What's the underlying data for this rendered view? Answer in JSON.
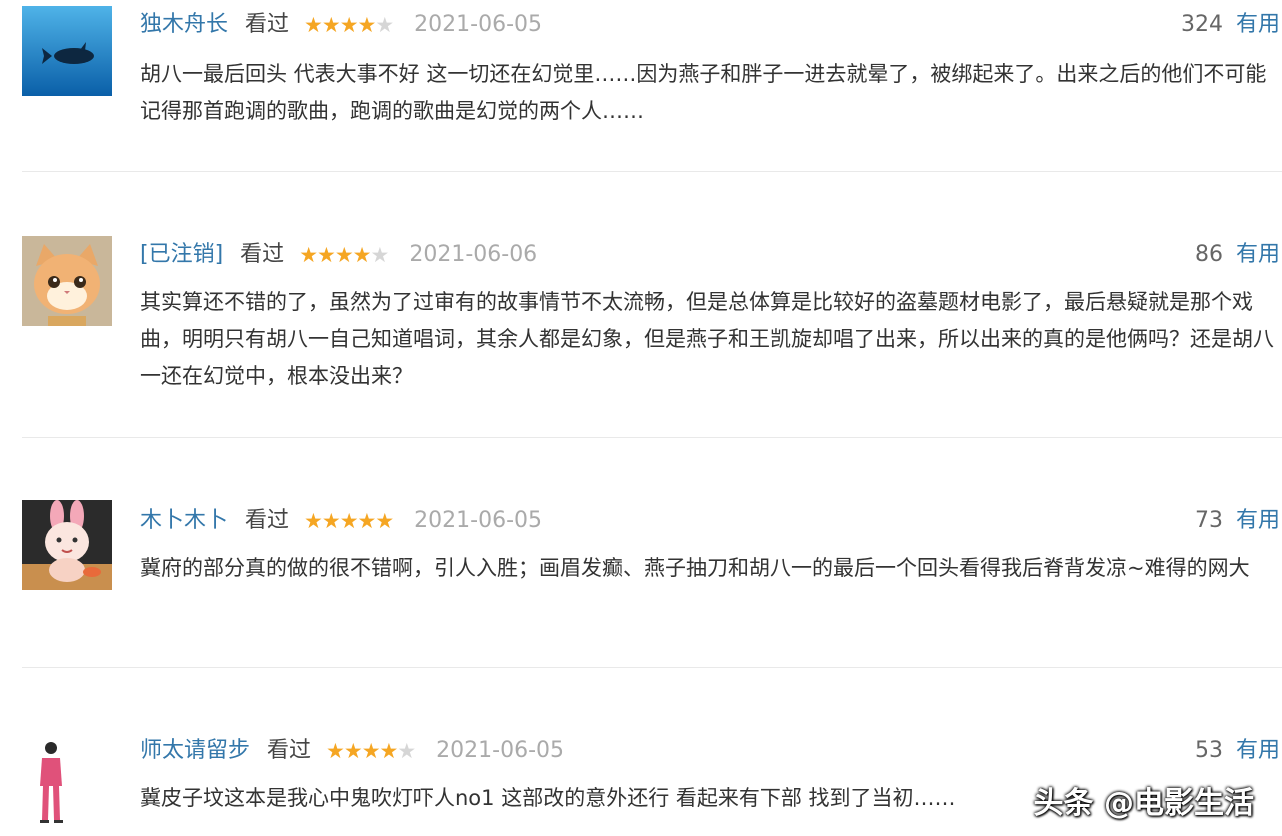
{
  "comments": [
    {
      "user": "独木舟长",
      "status": "看过",
      "rating": 4,
      "date": "2021-06-05",
      "votes": "324",
      "vote_label": "有用",
      "content": "胡八一最后回头 代表大事不好 这一切还在幻觉里……因为燕子和胖子一进去就晕了，被绑起来了。出来之后的他们不可能记得那首跑调的歌曲，跑调的歌曲是幻觉的两个人……"
    },
    {
      "user": "[已注销]",
      "status": "看过",
      "rating": 4,
      "date": "2021-06-06",
      "votes": "86",
      "vote_label": "有用",
      "content": "其实算还不错的了，虽然为了过审有的故事情节不太流畅，但是总体算是比较好的盗墓题材电影了，最后悬疑就是那个戏曲，明明只有胡八一自己知道唱词，其余人都是幻象，但是燕子和王凯旋却唱了出来，所以出来的真的是他俩吗？还是胡八一还在幻觉中，根本没出来？"
    },
    {
      "user": "木卜木卜",
      "status": "看过",
      "rating": 5,
      "date": "2021-06-05",
      "votes": "73",
      "vote_label": "有用",
      "content": "冀府的部分真的做的很不错啊，引人入胜；画眉发癫、燕子抽刀和胡八一的最后一个回头看得我后脊背发凉~难得的网大"
    },
    {
      "user": "师太请留步",
      "status": "看过",
      "rating": 4,
      "date": "2021-06-05",
      "votes": "53",
      "vote_label": "有用",
      "content": "冀皮子坟这本是我心中鬼吹灯吓人no1 这部改的意外还行 看起来有下部 找到了当初……"
    }
  ],
  "watermark": "头条 @电影生活",
  "colors": {
    "link": "#3377aa",
    "star": "#f5a623",
    "star_empty": "#d6d6d6",
    "date": "#aaaaaa",
    "divider": "#e9e9e9"
  },
  "icons": {
    "avatars": [
      "whale-avatar-icon",
      "cat-avatar-icon",
      "bunny-avatar-icon",
      "figure-avatar-icon"
    ],
    "star": "star-icon"
  }
}
